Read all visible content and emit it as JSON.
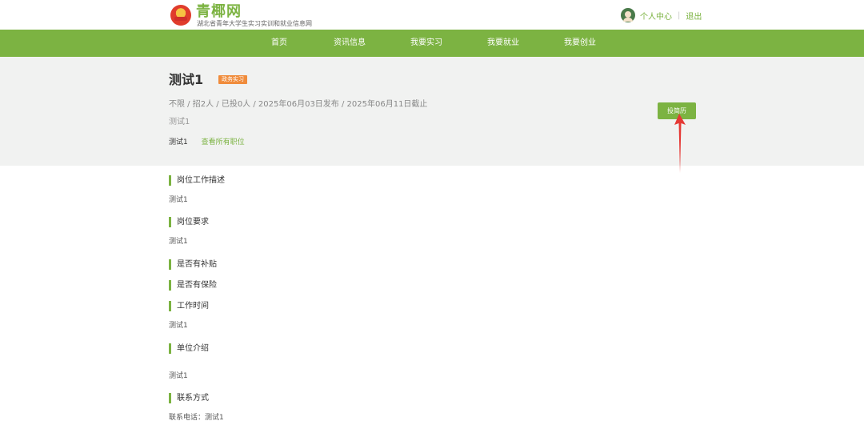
{
  "header": {
    "brand": "青椰网",
    "tagline": "湖北省青年大学生实习实训和就业信息网",
    "user_center": "个人中心",
    "logout": "退出"
  },
  "nav": {
    "items": [
      "首页",
      "资讯信息",
      "我要实习",
      "我要就业",
      "我要创业"
    ]
  },
  "job": {
    "title": "测试1",
    "tag": "政务实习",
    "meta": "不限 / 招2人 / 已投0人 / 2025年06月03日发布 / 2025年06月11日截止",
    "subtitle": "测试1",
    "company": "测试1",
    "all_positions": "查看所有职位",
    "apply_label": "投简历"
  },
  "sections": {
    "desc_title": "岗位工作描述",
    "desc_body": "测试1",
    "req_title": "岗位要求",
    "req_body": "测试1",
    "subsidy_title": "是否有补贴",
    "insurance_title": "是否有保险",
    "time_title": "工作时间",
    "time_body": "测试1",
    "unit_title": "单位介绍",
    "unit_body": "测试1",
    "contact_title": "联系方式",
    "contact_body": "联系电话：测试1"
  },
  "colors": {
    "accent": "#7cb342",
    "tag": "#f08c3c",
    "arrow": "#e53935"
  },
  "icons": [
    "logo-icon",
    "avatar-icon",
    "red-arrow-annotation"
  ]
}
